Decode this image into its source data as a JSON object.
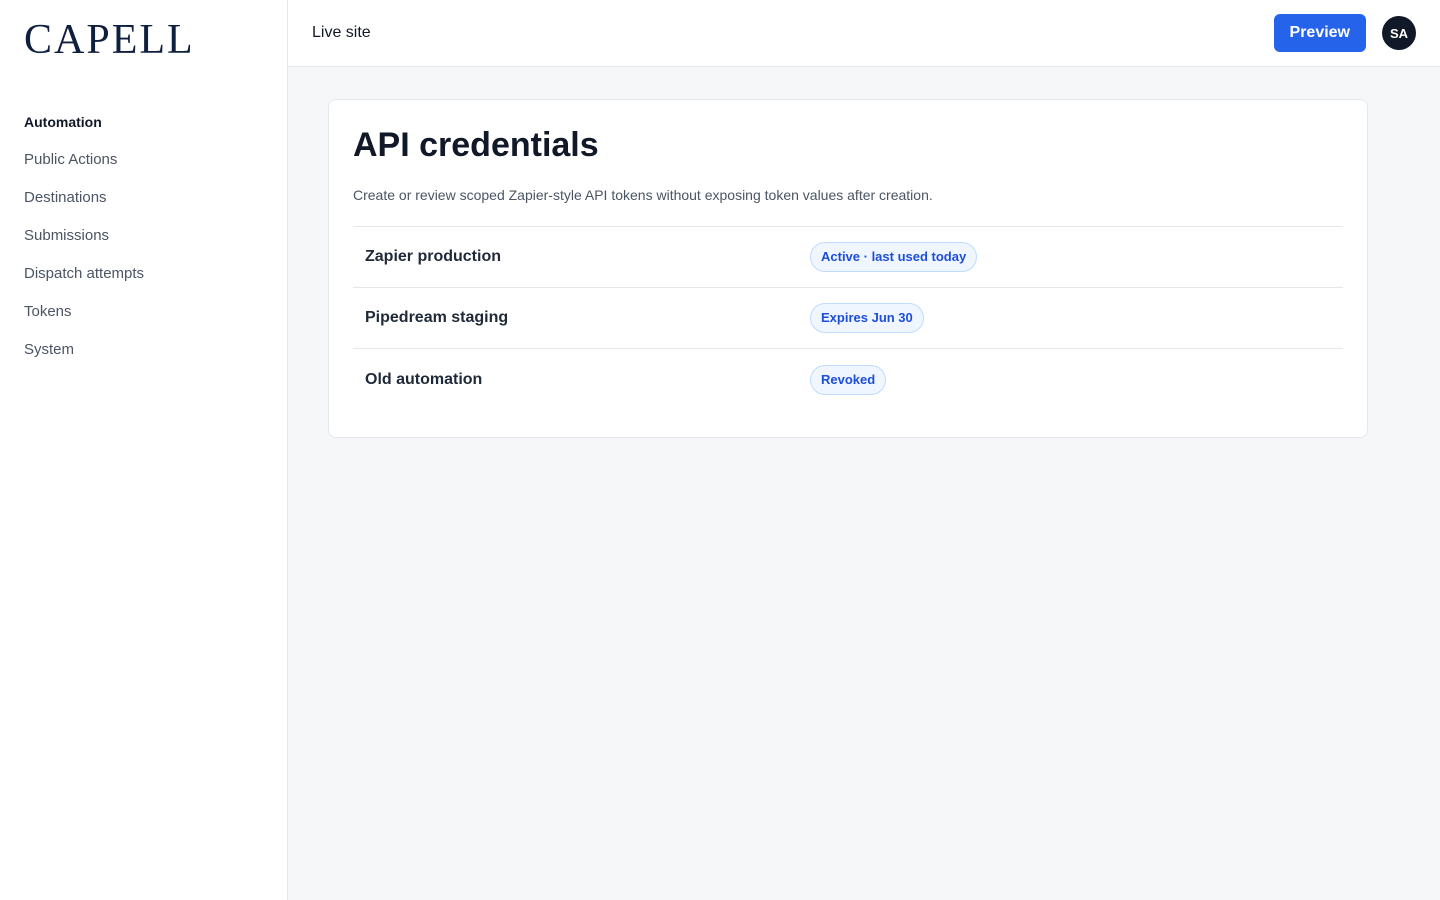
{
  "brand": {
    "logo_text": "CAPELL"
  },
  "sidebar": {
    "section_label": "Automation",
    "items": [
      {
        "label": "Public Actions"
      },
      {
        "label": "Destinations"
      },
      {
        "label": "Submissions"
      },
      {
        "label": "Dispatch attempts"
      },
      {
        "label": "Tokens"
      },
      {
        "label": "System"
      }
    ]
  },
  "topbar": {
    "live_site_label": "Live site",
    "preview_label": "Preview",
    "avatar_initials": "SA"
  },
  "main": {
    "title": "API credentials",
    "description": "Create or review scoped Zapier-style API tokens without exposing token values after creation.",
    "tokens": [
      {
        "name": "Zapier production",
        "status": "Active · last used today"
      },
      {
        "name": "Pipedream staging",
        "status": "Expires Jun 30"
      },
      {
        "name": "Old automation",
        "status": "Revoked"
      }
    ]
  },
  "colors": {
    "accent": "#2563eb",
    "logo": "#0f1f3d",
    "badge_text": "#1d4ed8",
    "badge_bg": "#eff6ff"
  }
}
